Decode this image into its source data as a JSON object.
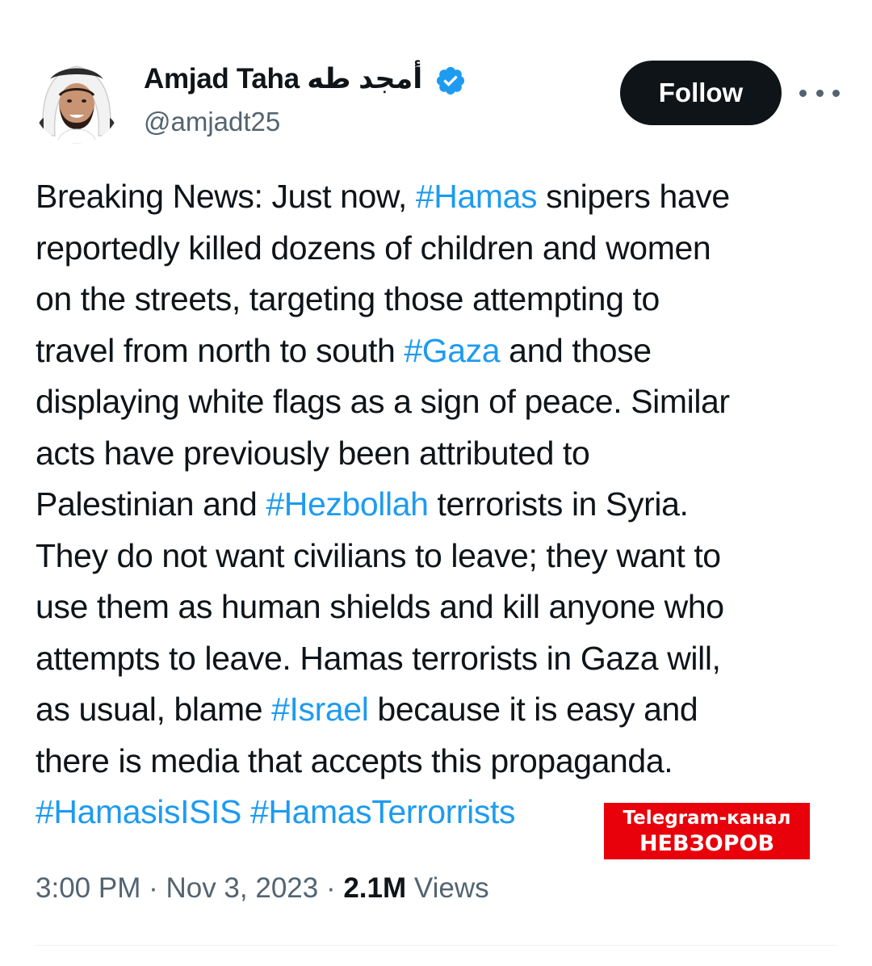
{
  "author": {
    "display_name": "Amjad Taha أمجد طه",
    "handle": "@amjadt25",
    "verified_icon": "verified-badge-icon",
    "avatar_icon": "avatar-photo"
  },
  "actions": {
    "follow_label": "Follow",
    "more_icon": "more-dots-icon"
  },
  "tweet": {
    "lines": [
      [
        {
          "t": "Breaking News: Just now, "
        },
        {
          "t": "#Hamas",
          "tag": true
        },
        {
          "t": " snipers have"
        }
      ],
      [
        {
          "t": "reportedly killed dozens of children and women"
        }
      ],
      [
        {
          "t": "on the streets, targeting those attempting to"
        }
      ],
      [
        {
          "t": "travel from north to south "
        },
        {
          "t": "#Gaza",
          "tag": true
        },
        {
          "t": " and those"
        }
      ],
      [
        {
          "t": "displaying white flags as a sign of peace. Similar"
        }
      ],
      [
        {
          "t": "acts have previously been attributed to"
        }
      ],
      [
        {
          "t": "Palestinian and "
        },
        {
          "t": "#Hezbollah",
          "tag": true
        },
        {
          "t": " terrorists in Syria."
        }
      ],
      [
        {
          "t": "They do not want civilians to leave; they want to"
        }
      ],
      [
        {
          "t": "use them as human shields and kill anyone who"
        }
      ],
      [
        {
          "t": "attempts to leave. Hamas terrorists in Gaza will,"
        }
      ],
      [
        {
          "t": "as usual, blame "
        },
        {
          "t": "#Israel",
          "tag": true
        },
        {
          "t": " because it is easy and"
        }
      ],
      [
        {
          "t": "there is media that accepts this propaganda."
        }
      ],
      [
        {
          "t": "#HamasisISIS",
          "tag": true
        },
        {
          "t": " "
        },
        {
          "t": "#HamasTerrorrists",
          "tag": true
        }
      ]
    ]
  },
  "meta": {
    "time": "3:00 PM",
    "sep1": " · ",
    "date": "Nov 3, 2023",
    "sep2": " · ",
    "views_count": "2.1M",
    "views_label": " Views"
  },
  "watermark": {
    "line1": "Telegram-канал",
    "line2": "НЕВЗОРОВ",
    "bg_color": "#e8000b"
  },
  "colors": {
    "hashtag": "#1d9bf0",
    "text": "#0f1419",
    "secondary": "#536471",
    "verified": "#1d9bf0"
  }
}
